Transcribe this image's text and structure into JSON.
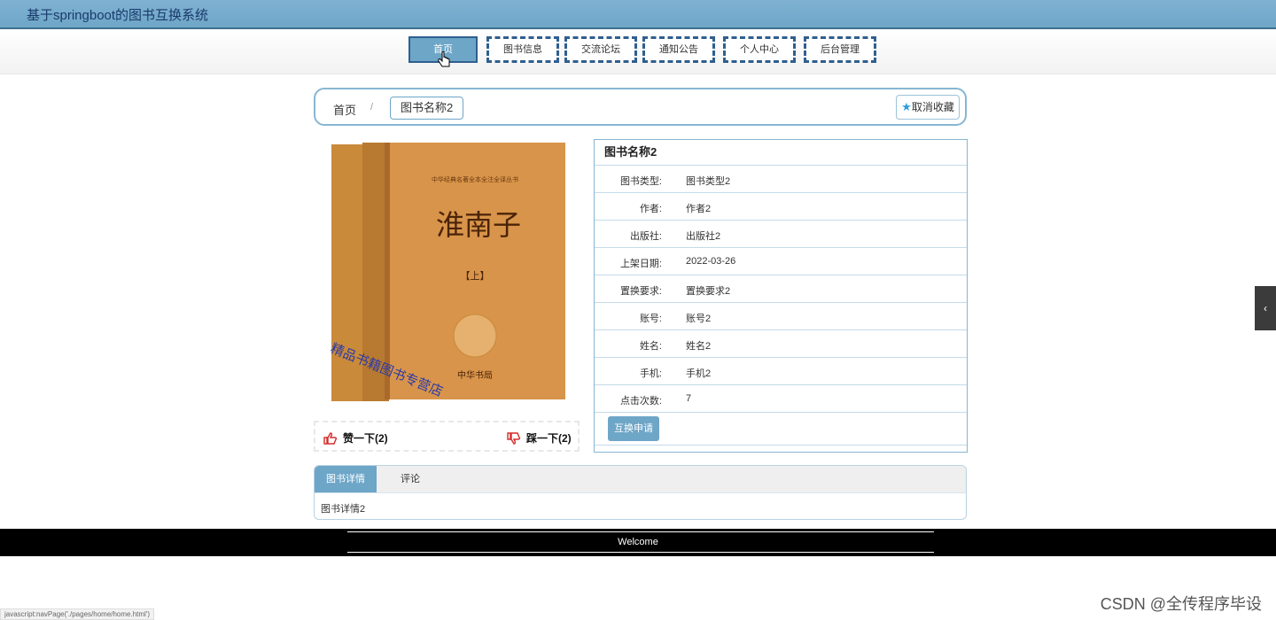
{
  "app": {
    "title": "基于springboot的图书互换系统"
  },
  "nav": {
    "items": [
      {
        "label": "首页",
        "active": true
      },
      {
        "label": "图书信息"
      },
      {
        "label": "交流论坛"
      },
      {
        "label": "通知公告"
      },
      {
        "label": "个人中心"
      },
      {
        "label": "后台管理"
      }
    ]
  },
  "breadcrumb": {
    "home": "首页",
    "separator": "/",
    "current": "图书名称2"
  },
  "favorite": {
    "label": "取消收藏",
    "icon": "star-icon"
  },
  "cover": {
    "series": "中华经典名著全本全注全译丛书",
    "title": "淮南子",
    "volume": "【上】",
    "publisher": "中华书局",
    "overlay": "精品书籍图书专营店"
  },
  "votes": {
    "like": "赞一下(2)",
    "dislike": "踩一下(2)"
  },
  "book": {
    "name": "图书名称2",
    "fields": [
      {
        "label": "图书类型:",
        "value": "图书类型2"
      },
      {
        "label": "作者:",
        "value": "作者2"
      },
      {
        "label": "出版社:",
        "value": "出版社2"
      },
      {
        "label": "上架日期:",
        "value": "2022-03-26"
      },
      {
        "label": "置换要求:",
        "value": "置换要求2"
      },
      {
        "label": "账号:",
        "value": "账号2"
      },
      {
        "label": "姓名:",
        "value": "姓名2"
      },
      {
        "label": "手机:",
        "value": "手机2"
      },
      {
        "label": "点击次数:",
        "value": "7"
      }
    ],
    "swap_button": "互换申请"
  },
  "tabs": {
    "items": [
      {
        "label": "图书详情",
        "active": true
      },
      {
        "label": "评论"
      }
    ],
    "content": "图书详情2"
  },
  "footer": {
    "text": "Welcome"
  },
  "status_bar": "javascript:navPage('./pages/home/home.html')",
  "watermark": "CSDN @全传程序毕设",
  "colors": {
    "accent": "#6ea6c8",
    "nav_border": "#2f5f8f",
    "footer": "#000000"
  }
}
